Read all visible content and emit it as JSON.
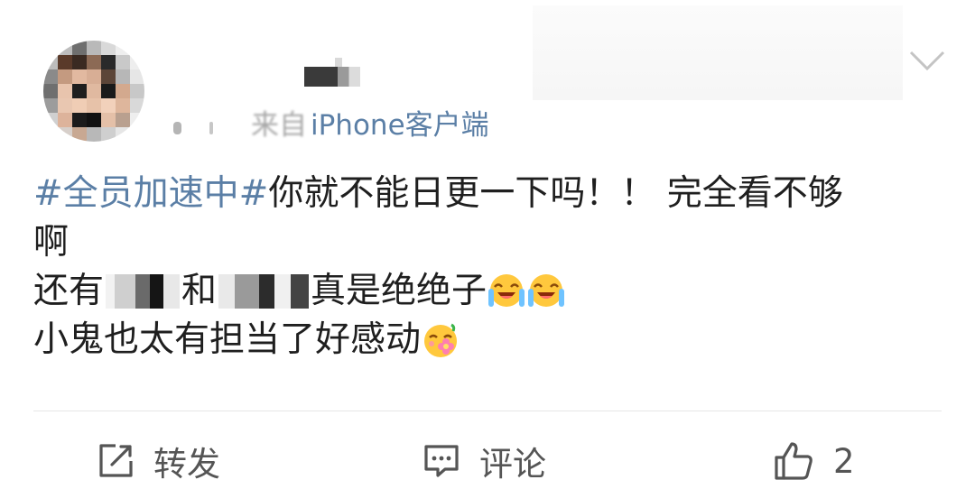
{
  "post": {
    "source": "iPhone客户端",
    "content": {
      "topic": "#全员加速中#",
      "line1_text": "你就不能日更一下吗！！ 完全看不够",
      "line2_text": "啊",
      "line3_prefix": "还有",
      "line3_mid": "和",
      "line3_suffix": "真是绝绝子",
      "line4_text": "小鬼也太有担当了好感动"
    },
    "emojis": [
      "laugh-cry-emoji",
      "laugh-cry-emoji",
      "flower-happy-emoji"
    ]
  },
  "actions": {
    "forward_label": "转发",
    "comment_label": "评论",
    "like_count": "2"
  },
  "colors": {
    "link": "#5b7fa6",
    "text": "#1f1f1f",
    "muted": "#9a9a9a",
    "action": "#555555"
  }
}
